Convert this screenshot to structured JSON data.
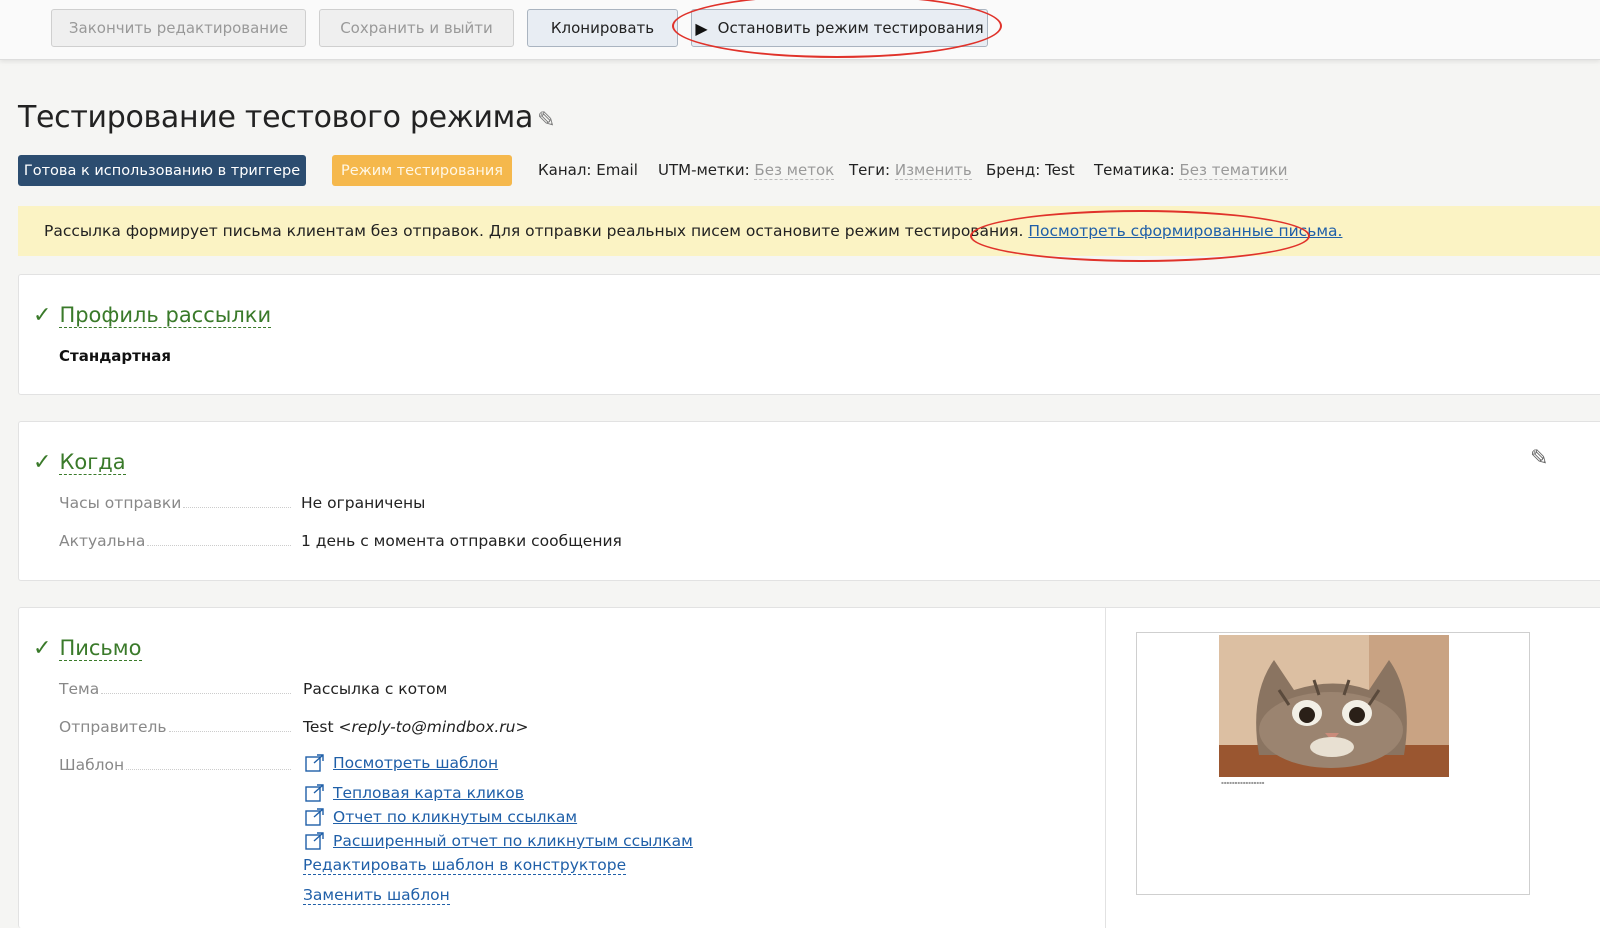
{
  "toolbar": {
    "finish_label": "Закончить редактирование",
    "save_exit_label": "Сохранить и выйти",
    "clone_label": "Клонировать",
    "stop_test_label": "Остановить режим тестирования"
  },
  "header": {
    "title": "Тестирование тестового режима"
  },
  "meta": {
    "status_badge": "Готова к использованию в триггере",
    "mode_badge": "Режим тестирования",
    "channel_label": "Канал:",
    "channel_value": "Email",
    "utm_label": "UTM-метки:",
    "utm_value": "Без меток",
    "tags_label": "Теги:",
    "tags_value": "Изменить",
    "brand_label": "Бренд:",
    "brand_value": "Test",
    "topic_label": "Тематика:",
    "topic_value": "Без тематики"
  },
  "notice": {
    "text": "Рассылка формирует письма клиентам без отправок. Для отправки реальных писем остановите режим тестирования.",
    "link": "Посмотреть сформированные письма."
  },
  "profile": {
    "title": "Профиль рассылки",
    "value": "Стандартная"
  },
  "when": {
    "title": "Когда",
    "rows": [
      {
        "label": "Часы отправки",
        "value": "Не ограничены"
      },
      {
        "label": "Актуальна",
        "value": "1 день с момента отправки сообщения"
      }
    ]
  },
  "letter": {
    "title": "Письмо",
    "subject_label": "Тема",
    "subject_value": "Рассылка с котом",
    "sender_label": "Отправитель",
    "sender_name": "Test ",
    "sender_email": "<reply-to@mindbox.ru>",
    "template_label": "Шаблон",
    "links": [
      "Посмотреть шаблон",
      "Тепловая карта кликов",
      "Отчет по кликнутым ссылкам",
      "Расширенный отчет по кликнутым ссылкам"
    ],
    "edit_link": "Редактировать шаблон в конструкторе",
    "replace_link": "Заменить шаблон"
  },
  "colors": {
    "accent_green": "#3a7a2a",
    "badge_blue": "#2c4d70",
    "badge_orange": "#f5b84c",
    "notice_bg": "#fbf3c4",
    "link_blue": "#1f5fa8",
    "highlight_red": "#e0322a"
  }
}
